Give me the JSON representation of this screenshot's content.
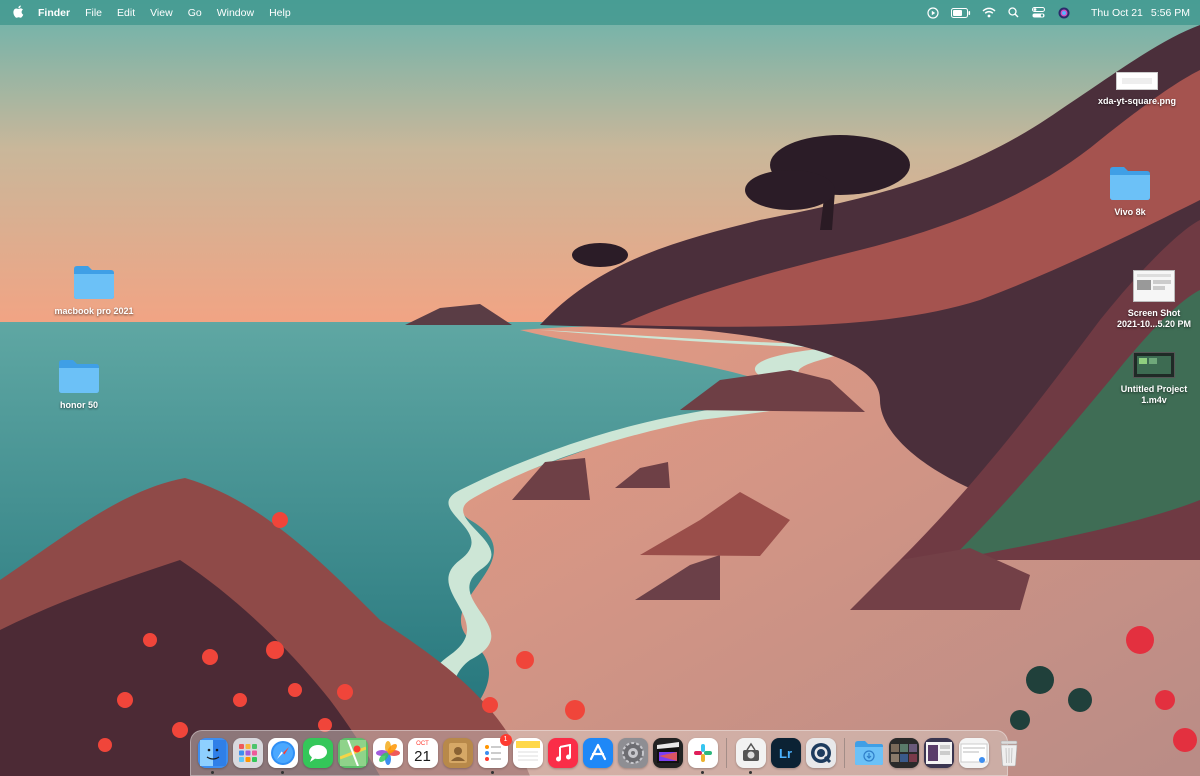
{
  "menubar": {
    "apple_icon": "apple-icon",
    "items": [
      "Finder",
      "File",
      "Edit",
      "View",
      "Go",
      "Window",
      "Help"
    ],
    "status_icons": [
      "play-icon",
      "battery-icon",
      "wifi-icon",
      "search-icon",
      "control-center-icon",
      "siri-icon"
    ],
    "date": "Thu Oct 21",
    "time": "5:56 PM"
  },
  "desktop": {
    "icons": [
      {
        "label": "xda-yt-square.png",
        "type": "image-file"
      },
      {
        "label": "Vivo 8k",
        "type": "folder"
      },
      {
        "label": "macbook pro 2021",
        "type": "folder"
      },
      {
        "label": "honor 50",
        "type": "folder"
      },
      {
        "label": "Screen Shot 2021-10...5.20 PM",
        "line1": "Screen Shot",
        "line2": "2021-10...5.20 PM",
        "type": "screenshot-file"
      },
      {
        "label": "Untitled Project 1.m4v",
        "line1": "Untitled Project",
        "line2": "1.m4v",
        "type": "video-file"
      }
    ]
  },
  "dock": {
    "apps": [
      {
        "name": "Finder",
        "icon": "finder-icon",
        "color": "#3d8ef0"
      },
      {
        "name": "Launchpad",
        "icon": "launchpad-icon",
        "color": "#d9d9de"
      },
      {
        "name": "Safari",
        "icon": "safari-icon",
        "color": "#2f8ff5"
      },
      {
        "name": "Messages",
        "icon": "messages-icon",
        "color": "#34c759"
      },
      {
        "name": "Maps",
        "icon": "maps-icon",
        "color": "#5bc06a"
      },
      {
        "name": "Photos",
        "icon": "photos-icon",
        "color": "#ffffff"
      },
      {
        "name": "Calendar",
        "icon": "calendar-icon",
        "color": "#ffffff",
        "month": "OCT",
        "day": "21"
      },
      {
        "name": "Contacts",
        "icon": "contacts-icon",
        "color": "#b8894a"
      },
      {
        "name": "Reminders",
        "icon": "reminders-icon",
        "color": "#ffffff",
        "badge": "1"
      },
      {
        "name": "Notes",
        "icon": "notes-icon",
        "color": "#ffd84a"
      },
      {
        "name": "Music",
        "icon": "music-icon",
        "color": "#fa2d48"
      },
      {
        "name": "App Store",
        "icon": "app-store-icon",
        "color": "#1e88f7"
      },
      {
        "name": "System Preferences",
        "icon": "gear-icon",
        "color": "#8e8e93"
      },
      {
        "name": "Final Cut Pro",
        "icon": "final-cut-icon",
        "color": "#222222"
      },
      {
        "name": "Slack",
        "icon": "slack-icon",
        "color": "#ffffff"
      },
      {
        "name": "Image Capture",
        "icon": "image-capture-icon",
        "color": "#f2f2f2"
      },
      {
        "name": "Lightroom",
        "icon": "lightroom-icon",
        "color": "#0b2234",
        "text": "Lr"
      },
      {
        "name": "QuickTime Player",
        "icon": "quicktime-icon",
        "color": "#e8e8ea"
      },
      {
        "name": "Downloads",
        "icon": "downloads-folder-icon",
        "color": "#5fb4ef"
      },
      {
        "name": "Recent Items",
        "icon": "stack-icon",
        "color": "#2a2a2a"
      },
      {
        "name": "Screen Shot stack",
        "icon": "screenshot-stack-icon",
        "color": "#3a3550"
      },
      {
        "name": "Document stack",
        "icon": "document-stack-icon",
        "color": "#f4f4f4"
      },
      {
        "name": "Trash",
        "icon": "trash-icon",
        "color": "#d6d6d6"
      }
    ]
  }
}
